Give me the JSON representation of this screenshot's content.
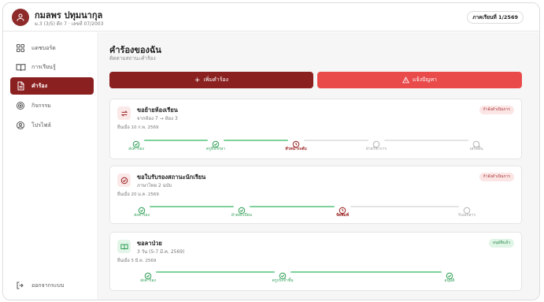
{
  "header": {
    "user_name": "กมลพร ปทุมนากุล",
    "user_sub": "ม.3 (3/5) ตึก 7 · เลขที่ 07/2003",
    "semester": "ภาคเรียนที่ 1/2569"
  },
  "sidebar": {
    "items": [
      {
        "label": "แดชบอร์ด",
        "icon": "grid-icon",
        "active": false
      },
      {
        "label": "การเรียนรู้",
        "icon": "book-icon",
        "active": false
      },
      {
        "label": "คำร้อง",
        "icon": "document-icon",
        "active": true
      },
      {
        "label": "กิจกรรม",
        "icon": "target-icon",
        "active": false
      },
      {
        "label": "โปรไฟล์",
        "icon": "user-circle-icon",
        "active": false
      }
    ],
    "logout_label": "ออกจากระบบ"
  },
  "main": {
    "title": "คำร้องของฉัน",
    "subtitle": "ติดตามสถานะคำร้อง",
    "add_button": "เพิ่มคำร้อง",
    "report_button": "แจ้งปัญหา"
  },
  "requests": [
    {
      "title": "ขอย้ายห้องเรียน",
      "detail": "จากห้อง 7 → ห้อง 3",
      "date": "ยื่นเมื่อ 10 ก.พ. 2569",
      "status": "กำลังดำเนินการ",
      "status_type": "pending",
      "icon": "swap-icon",
      "steps": [
        {
          "label": "ส่งคำร้อง",
          "state": "done"
        },
        {
          "label": "ครูที่ปรึกษา",
          "state": "done"
        },
        {
          "label": "หัวหน้าระดับ",
          "state": "current"
        },
        {
          "label": "ฝ่ายวิชาการ",
          "state": "pending"
        },
        {
          "label": "เสร็จสิ้น",
          "state": "pending"
        }
      ]
    },
    {
      "title": "ขอใบรับรองสถานะนักเรียน",
      "detail": "ภาษาไทย 2 ฉบับ",
      "date": "ยื่นเมื่อ 20 ม.ค. 2569",
      "status": "กำลังดำเนินการ",
      "status_type": "pending",
      "icon": "check-circle-icon",
      "steps": [
        {
          "label": "ส่งคำร้อง",
          "state": "done"
        },
        {
          "label": "ฝ่ายทะเบียน",
          "state": "done"
        },
        {
          "label": "จัดพิมพ์",
          "state": "current"
        },
        {
          "label": "รับเอกสาร",
          "state": "pending"
        }
      ]
    },
    {
      "title": "ขอลาป่วย",
      "detail": "3 วัน (5-7 มี.ค. 2569)",
      "date": "ยื่นเมื่อ 5 มี.ค. 2569",
      "status": "อนุมัติแล้ว",
      "status_type": "done",
      "icon": "book-open-icon",
      "steps": [
        {
          "label": "ส่งคำร้อง",
          "state": "done"
        },
        {
          "label": "ครูประจำชั้น",
          "state": "done"
        },
        {
          "label": "อนุมัติ",
          "state": "done"
        }
      ]
    }
  ],
  "colors": {
    "brand": "#8b2020",
    "danger": "#e94b4b",
    "success": "#2e9e55",
    "success_line": "#7ed39a"
  }
}
